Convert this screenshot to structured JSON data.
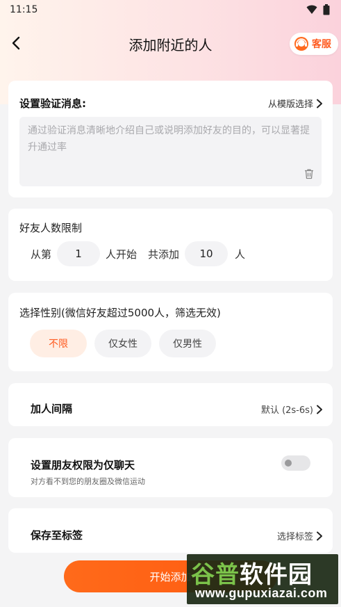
{
  "status": {
    "time": "11:15"
  },
  "header": {
    "title": "添加附近的人",
    "service_label": "客服"
  },
  "verify": {
    "title": "设置验证消息:",
    "template_link": "从模版选择",
    "placeholder": "通过验证消息清晰地介绍自己或说明添加好友的目的，可以显著提升通过率"
  },
  "limit": {
    "label": "好友人数限制",
    "from_prefix": "从第",
    "from_value": "1",
    "from_suffix": "人开始",
    "total_prefix": "共添加",
    "total_value": "10",
    "total_suffix": "人"
  },
  "gender": {
    "label": "选择性别(微信好友超过5000人，筛选无效)",
    "options": [
      "不限",
      "仅女性",
      "仅男性"
    ],
    "selected": "不限"
  },
  "interval": {
    "label": "加人间隔",
    "value": "默认 (2s-6s)"
  },
  "privacy": {
    "label": "设置朋友权限为仅聊天",
    "desc": "对方看不到您的朋友圈及微信运动",
    "enabled": false
  },
  "tag": {
    "label": "保存至标签",
    "value": "选择标签"
  },
  "start_button": "开始添加",
  "watermark": {
    "title": "谷普软件园",
    "url": "www.gupuxiazai.com"
  },
  "colors": {
    "accent": "#ff5a1f",
    "accent_bg": "#ffeee4"
  }
}
